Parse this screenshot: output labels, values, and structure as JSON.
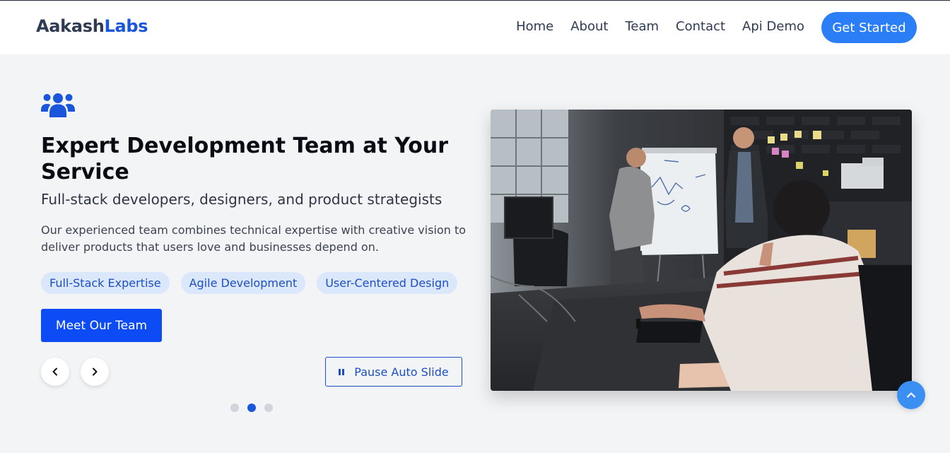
{
  "brand": {
    "part1": "Aakash",
    "part2": "Labs"
  },
  "nav": {
    "links": [
      "Home",
      "About",
      "Team",
      "Contact",
      "Api Demo"
    ],
    "cta_label": "Get Started"
  },
  "hero": {
    "icon": "users-icon",
    "title": "Expert Development Team at Your Service",
    "subtitle": "Full-stack developers, designers, and product strategists",
    "description": "Our experienced team combines technical expertise with creative vision to deliver products that users love and businesses depend on.",
    "tags": [
      "Full-Stack Expertise",
      "Agile Development",
      "User-Centered Design"
    ],
    "primary_button": "Meet Our Team",
    "pause_label": "Pause Auto Slide"
  },
  "carousel": {
    "slide_count": 3,
    "active_index": 1
  },
  "colors": {
    "brand_blue": "#1a56db",
    "cta_blue": "#2b7ef5",
    "tag_bg": "#dbe7fb",
    "page_bg": "#f3f4f6"
  }
}
